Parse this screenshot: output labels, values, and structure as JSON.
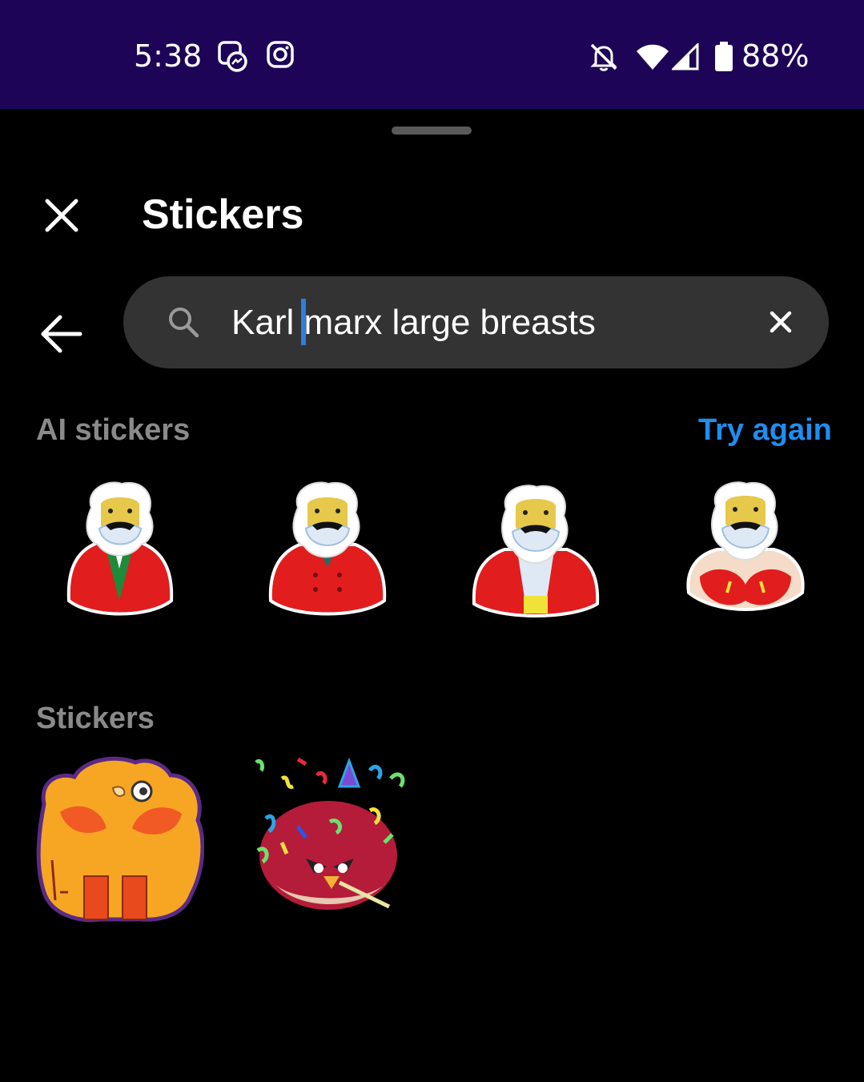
{
  "status_bar": {
    "time": "5:38",
    "battery_percent": "88%",
    "icons": [
      "messenger-icon",
      "instagram-icon",
      "bell-muted-icon",
      "wifi-icon",
      "signal-icon",
      "battery-icon"
    ]
  },
  "sheet": {
    "title": "Stickers"
  },
  "search": {
    "value": "Karl marx large breasts"
  },
  "ai_stickers": {
    "label": "AI stickers",
    "try_again_label": "Try again"
  },
  "stickers": {
    "label": "Stickers"
  },
  "colors": {
    "status_bar_bg": "#1d0457",
    "accent": "#1e8ef0",
    "search_bg": "#333333",
    "caret": "#2f7de1"
  }
}
